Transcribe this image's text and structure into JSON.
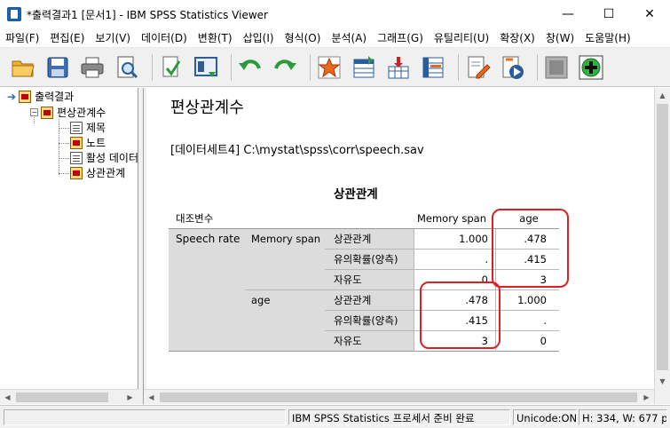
{
  "window": {
    "title": "*출력결과1 [문서1] - IBM SPSS Statistics Viewer",
    "minimize_glyph": "—",
    "maximize_glyph": "☐",
    "close_glyph": "✕"
  },
  "menu": [
    "파일(F)",
    "편집(E)",
    "보기(V)",
    "데이터(D)",
    "변환(T)",
    "삽입(I)",
    "형식(O)",
    "분석(A)",
    "그래프(G)",
    "유틸리티(U)",
    "확장(X)",
    "창(W)",
    "도움말(H)"
  ],
  "toolbar": {
    "icons": [
      "open-folder-icon",
      "save-icon",
      "print-icon",
      "print-preview-icon",
      "export-icon",
      "recall-dialog-icon",
      "undo-icon",
      "redo-icon",
      "goto-data-icon",
      "goto-case-icon",
      "goto-variable-icon",
      "variables-icon",
      "edit-script-icon",
      "run-script-icon",
      "designate-window-icon",
      "add-icon"
    ]
  },
  "outline": {
    "root": "출력결과",
    "group": "편상관계수",
    "items": [
      "제목",
      "노트",
      "활성 데이터",
      "상관관계"
    ]
  },
  "content": {
    "heading": "편상관계수",
    "dataset": "[데이터세트4] C:\\mystat\\spss\\corr\\speech.sav",
    "table_title": "상관관계",
    "table": {
      "control_header": "대조변수",
      "col1_header": "Memory span",
      "col2_header": "age",
      "control_var": "Speech rate",
      "rows": [
        {
          "var": "Memory span",
          "stat": "상관관계",
          "v1": "1.000",
          "v2": ".478"
        },
        {
          "var": "",
          "stat": "유의확률(양측)",
          "v1": ".",
          "v2": ".415"
        },
        {
          "var": "",
          "stat": "자유도",
          "v1": "0",
          "v2": "3"
        },
        {
          "var": "age",
          "stat": "상관관계",
          "v1": ".478",
          "v2": "1.000"
        },
        {
          "var": "",
          "stat": "유의확률(양측)",
          "v1": ".415",
          "v2": "."
        },
        {
          "var": "",
          "stat": "자유도",
          "v1": "3",
          "v2": "0"
        }
      ]
    }
  },
  "status": {
    "processor": "IBM SPSS Statistics 프로세서 준비 완료",
    "unicode": "Unicode:ON",
    "size": "H: 334, W: 677 pt."
  },
  "colors": {
    "highlight_box": "#e02020",
    "shade": "#dcdcdc"
  }
}
